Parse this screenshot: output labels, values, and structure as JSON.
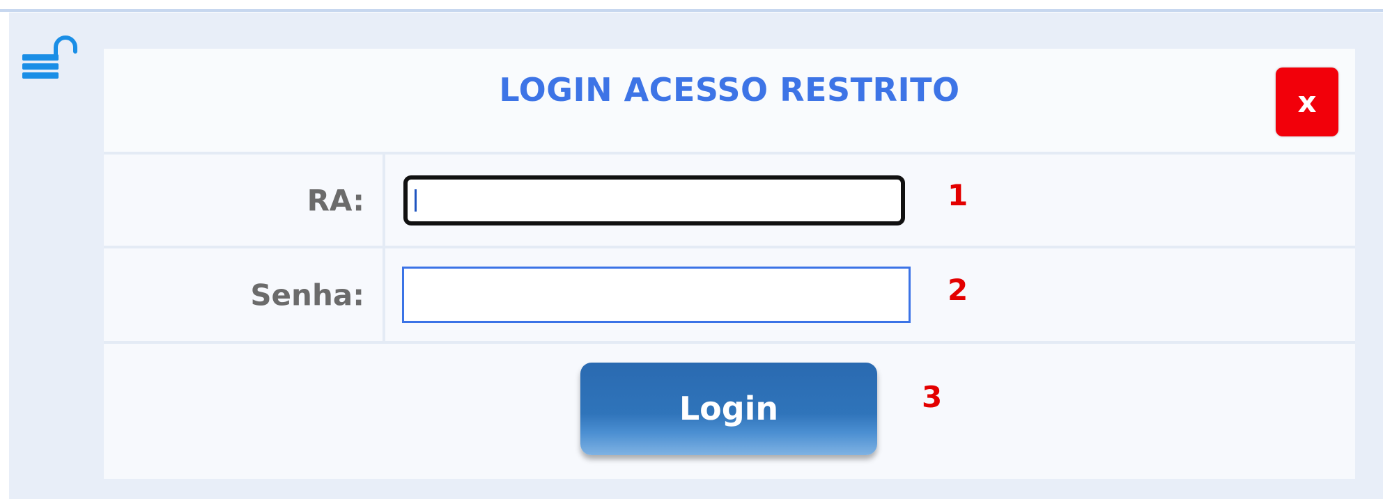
{
  "dialog": {
    "title": "LOGIN ACESSO RESTRITO",
    "close_label": "x"
  },
  "form": {
    "ra_label": "RA:",
    "ra_value": "",
    "senha_label": "Senha:",
    "senha_value": "",
    "login_label": "Login"
  },
  "annotations": {
    "step1": "1",
    "step2": "2",
    "step3": "3"
  },
  "icons": {
    "lock": "unlocked-padlock-icon"
  },
  "colors": {
    "title": "#3d74e6",
    "close_button": "#f2000a",
    "login_button": "#2f74ba",
    "annotation": "#e30000"
  }
}
